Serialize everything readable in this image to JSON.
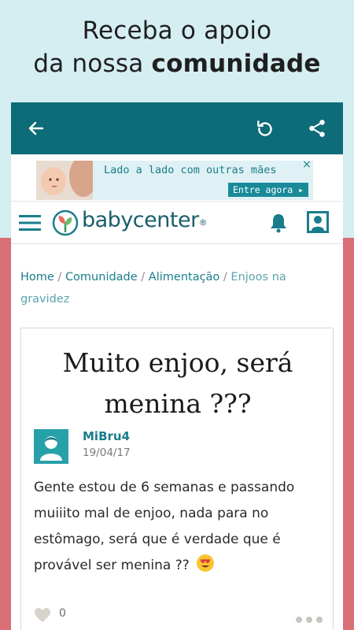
{
  "promo": {
    "line1": "Receba o apoio",
    "line2_prefix": "da nossa ",
    "line2_bold": "comunidade"
  },
  "appbar": {
    "icons": [
      "back-arrow-icon",
      "refresh-icon",
      "share-icon"
    ],
    "color": "#0e6b78"
  },
  "ad": {
    "text": "Lado a lado com outras mães",
    "cta": "Entre agora ▸",
    "close": "×"
  },
  "navbar": {
    "logo_text": "babycenter",
    "logo_mark": "®",
    "icons": [
      "menu-icon",
      "bell-icon",
      "profile-icon"
    ]
  },
  "breadcrumb": {
    "items": [
      "Home",
      "Comunidade",
      "Alimentação"
    ],
    "current": "Enjoos na gravidez",
    "separator": " / "
  },
  "post": {
    "title": "Muito enjoo, será menina ???",
    "author": "MiBru4",
    "date": "19/04/17",
    "body": "Gente estou de 6 semanas e passando muiiito mal de enjoo, nada para no estômago, será que é verdade que é provável ser menina ??",
    "likes": "0"
  },
  "colors": {
    "accent": "#1a7d8c",
    "top_background": "#d5eef2",
    "bottom_background": "#d96e74"
  }
}
